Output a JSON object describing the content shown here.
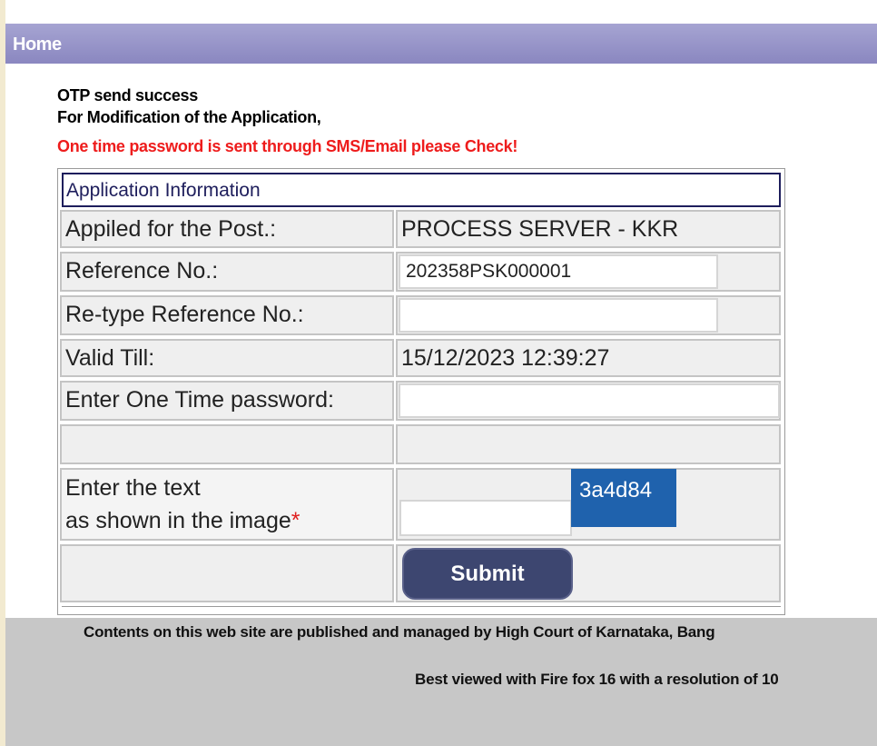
{
  "nav": {
    "home_label": "Home"
  },
  "messages": {
    "status": "OTP send success",
    "purpose": "For Modification of the Application,",
    "alert": "One time password is sent through SMS/Email please Check!"
  },
  "form": {
    "header": "Application Information",
    "post_label": "Appiled for the Post.:",
    "post_value": "PROCESS SERVER - KKR",
    "reference_label": "Reference No.:",
    "reference_value": "202358PSK000001",
    "retype_label": "Re-type Reference No.:",
    "retype_value": "",
    "valid_label": "Valid Till:",
    "valid_value": "15/12/2023 12:39:27",
    "otp_label": "Enter One Time password:",
    "otp_value": "",
    "captcha_label_line1": "Enter the text",
    "captcha_label_line2": "as shown in the image",
    "required_mark": "*",
    "captcha_text": "3a4d84",
    "captcha_value": "",
    "submit_label": "Submit"
  },
  "footer": {
    "line1": "Contents on this web site are published and managed by High Court of Karnataka, Bang",
    "line2": "Best viewed with Fire fox 16 with a resolution of 10"
  },
  "colors": {
    "nav_bar": "#9b99cb",
    "alert_text": "#ee1c1c",
    "captcha_bg": "#1f62ad",
    "submit_bg": "#3d4670",
    "footer_bg": "#c7c7c7"
  }
}
